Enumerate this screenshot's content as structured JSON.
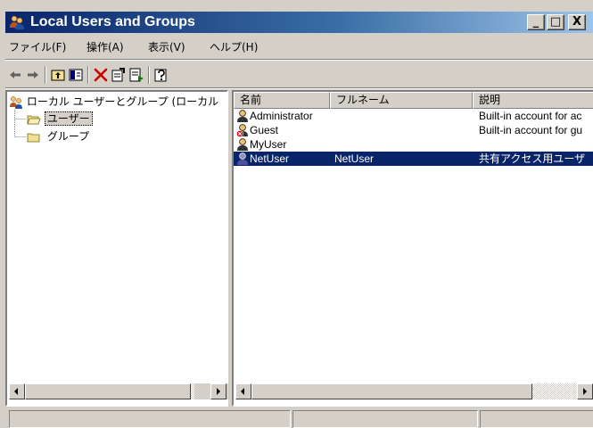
{
  "window": {
    "title": "Local Users and Groups",
    "app_icon": "users-and-groups-icon",
    "controls": {
      "minimize": "_",
      "maximize": "□",
      "close": "X"
    }
  },
  "menu": [
    {
      "label": "ファイル(F)"
    },
    {
      "label": "操作(A)"
    },
    {
      "label": "表示(V)"
    },
    {
      "label": "ヘルプ(H)"
    }
  ],
  "toolbar": {
    "buttons": [
      "back-icon",
      "forward-icon",
      "up-level-icon",
      "show-hide-tree-icon",
      "delete-icon",
      "properties-icon",
      "export-list-icon",
      "help-icon"
    ]
  },
  "tree": {
    "root": {
      "label": "ローカル ユーザーとグループ (ローカル",
      "icon": "users-and-groups-icon"
    },
    "children": [
      {
        "label": "ユーザー",
        "icon": "folder-open-icon",
        "selected": true
      },
      {
        "label": "グループ",
        "icon": "folder-icon",
        "selected": false
      }
    ]
  },
  "list": {
    "columns": [
      "名前",
      "フルネーム",
      "説明"
    ],
    "rows": [
      {
        "name": "Administrator",
        "fullname": "",
        "description": "Built-in account for ac",
        "icon": "user-icon",
        "disabled": false,
        "selected": false
      },
      {
        "name": "Guest",
        "fullname": "",
        "description": "Built-in account for gu",
        "icon": "user-disabled-icon",
        "disabled": true,
        "selected": false
      },
      {
        "name": "MyUser",
        "fullname": "",
        "description": "",
        "icon": "user-icon",
        "disabled": false,
        "selected": false
      },
      {
        "name": "NetUser",
        "fullname": "NetUser",
        "description": "共有アクセス用ユーザ",
        "icon": "user-icon",
        "disabled": false,
        "selected": true
      }
    ]
  },
  "status": {
    "cells": [
      "",
      "",
      ""
    ]
  },
  "colors": {
    "title_gradient_start": "#0a246a",
    "title_gradient_end": "#a6caf0",
    "selection": "#0a246a",
    "face": "#d4d0c8"
  }
}
